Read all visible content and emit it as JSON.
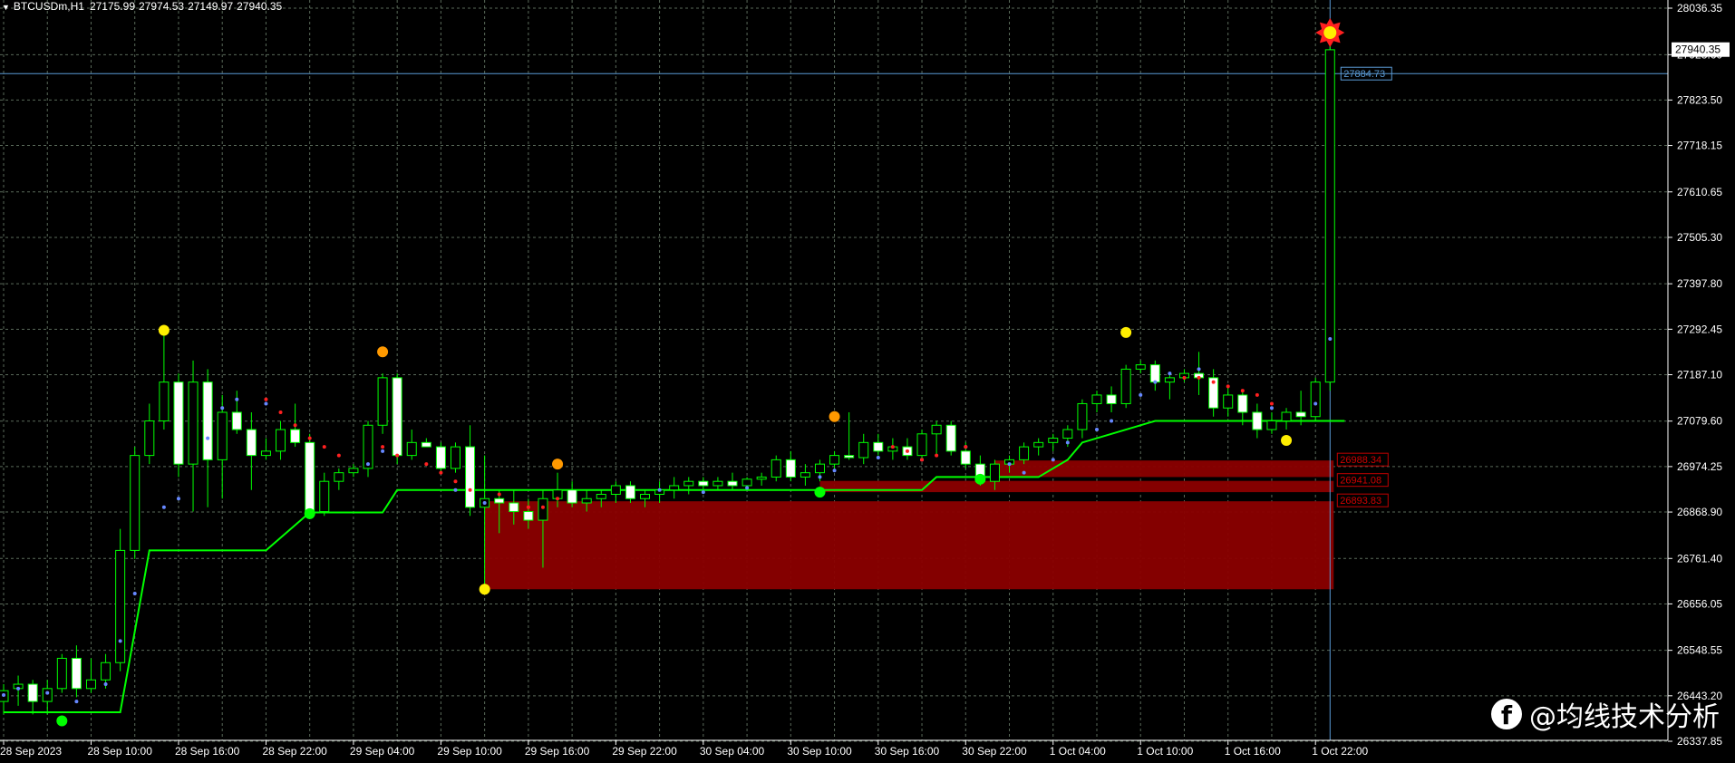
{
  "header": {
    "symbol": "BTCUSDm,H1",
    "open": "27175.99",
    "high": "27974.53",
    "low": "27149.97",
    "close": "27940.35"
  },
  "watermark": {
    "text": "@均线技术分析",
    "icon": "facebook-icon"
  },
  "colors": {
    "background": "#000000",
    "grid": "#5a6a5a",
    "axis": "#ffffff",
    "bull_wick": "#00ff00",
    "bear_body": "#ffffff",
    "trail_line": "#00ff00",
    "zone_fill": "#8b0000",
    "hline": "#5b9bd5",
    "swing_high": "#ffee00",
    "swing_mid": "#ff9900",
    "swing_low": "#00ff00",
    "dot_blue": "#6688ff",
    "dot_red": "#ff2020"
  },
  "chart_data": {
    "type": "candlestick",
    "symbol": "BTCUSDm",
    "timeframe": "H1",
    "ylim": [
      26337.85,
      28036.35
    ],
    "y_ticks": [
      "28036.35",
      "27928.60",
      "27823.50",
      "27718.15",
      "27610.65",
      "27505.30",
      "27397.80",
      "27292.45",
      "27187.10",
      "27079.60",
      "26974.25",
      "26868.90",
      "26761.40",
      "26656.05",
      "26548.55",
      "26443.20",
      "26337.85"
    ],
    "x_ticks": [
      "28 Sep 2023",
      "28 Sep 10:00",
      "28 Sep 16:00",
      "28 Sep 22:00",
      "29 Sep 04:00",
      "29 Sep 10:00",
      "29 Sep 16:00",
      "29 Sep 22:00",
      "30 Sep 04:00",
      "30 Sep 10:00",
      "30 Sep 16:00",
      "30 Sep 22:00",
      "1 Oct 04:00",
      "1 Oct 10:00",
      "1 Oct 16:00",
      "1 Oct 22:00"
    ],
    "x_tick_bars": [
      0,
      6,
      12,
      18,
      24,
      30,
      36,
      42,
      48,
      54,
      60,
      66,
      72,
      78,
      84,
      90
    ],
    "candles": [
      {
        "o": 26430,
        "h": 26470,
        "l": 26400,
        "c": 26455
      },
      {
        "o": 26460,
        "h": 26490,
        "l": 26420,
        "c": 26470
      },
      {
        "o": 26470,
        "h": 26480,
        "l": 26400,
        "c": 26430
      },
      {
        "o": 26430,
        "h": 26480,
        "l": 26400,
        "c": 26460
      },
      {
        "o": 26460,
        "h": 26540,
        "l": 26450,
        "c": 26530
      },
      {
        "o": 26530,
        "h": 26560,
        "l": 26440,
        "c": 26460
      },
      {
        "o": 26460,
        "h": 26530,
        "l": 26450,
        "c": 26480
      },
      {
        "o": 26480,
        "h": 26540,
        "l": 26460,
        "c": 26520
      },
      {
        "o": 26520,
        "h": 26830,
        "l": 26500,
        "c": 26780
      },
      {
        "o": 26780,
        "h": 27020,
        "l": 26760,
        "c": 27000
      },
      {
        "o": 27000,
        "h": 27120,
        "l": 26980,
        "c": 27080
      },
      {
        "o": 27080,
        "h": 27290,
        "l": 27060,
        "c": 27170
      },
      {
        "o": 27170,
        "h": 27190,
        "l": 26950,
        "c": 26980
      },
      {
        "o": 26980,
        "h": 27220,
        "l": 26870,
        "c": 27170
      },
      {
        "o": 27170,
        "h": 27200,
        "l": 26880,
        "c": 26990
      },
      {
        "o": 26990,
        "h": 27140,
        "l": 26900,
        "c": 27100
      },
      {
        "o": 27100,
        "h": 27150,
        "l": 27050,
        "c": 27060
      },
      {
        "o": 27060,
        "h": 27100,
        "l": 26920,
        "c": 27000
      },
      {
        "o": 27000,
        "h": 27040,
        "l": 26990,
        "c": 27010
      },
      {
        "o": 27010,
        "h": 27080,
        "l": 26990,
        "c": 27060
      },
      {
        "o": 27060,
        "h": 27120,
        "l": 27020,
        "c": 27030
      },
      {
        "o": 27030,
        "h": 27050,
        "l": 26860,
        "c": 26870
      },
      {
        "o": 26870,
        "h": 26960,
        "l": 26860,
        "c": 26940
      },
      {
        "o": 26940,
        "h": 26970,
        "l": 26920,
        "c": 26960
      },
      {
        "o": 26960,
        "h": 26980,
        "l": 26950,
        "c": 26970
      },
      {
        "o": 26970,
        "h": 27080,
        "l": 26950,
        "c": 27070
      },
      {
        "o": 27070,
        "h": 27190,
        "l": 27050,
        "c": 27180
      },
      {
        "o": 27180,
        "h": 27190,
        "l": 26980,
        "c": 27000
      },
      {
        "o": 27000,
        "h": 27060,
        "l": 26990,
        "c": 27030
      },
      {
        "o": 27030,
        "h": 27040,
        "l": 27020,
        "c": 27020
      },
      {
        "o": 27020,
        "h": 27030,
        "l": 26960,
        "c": 26970
      },
      {
        "o": 26970,
        "h": 27030,
        "l": 26960,
        "c": 27020
      },
      {
        "o": 27020,
        "h": 27070,
        "l": 26860,
        "c": 26880
      },
      {
        "o": 26880,
        "h": 27000,
        "l": 26700,
        "c": 26900
      },
      {
        "o": 26900,
        "h": 26920,
        "l": 26820,
        "c": 26890
      },
      {
        "o": 26890,
        "h": 26920,
        "l": 26840,
        "c": 26870
      },
      {
        "o": 26870,
        "h": 26900,
        "l": 26830,
        "c": 26850
      },
      {
        "o": 26850,
        "h": 26920,
        "l": 26740,
        "c": 26900
      },
      {
        "o": 26900,
        "h": 26960,
        "l": 26880,
        "c": 26920
      },
      {
        "o": 26920,
        "h": 26940,
        "l": 26880,
        "c": 26890
      },
      {
        "o": 26890,
        "h": 26920,
        "l": 26870,
        "c": 26900
      },
      {
        "o": 26900,
        "h": 26920,
        "l": 26880,
        "c": 26910
      },
      {
        "o": 26910,
        "h": 26940,
        "l": 26890,
        "c": 26930
      },
      {
        "o": 26930,
        "h": 26940,
        "l": 26890,
        "c": 26900
      },
      {
        "o": 26900,
        "h": 26920,
        "l": 26880,
        "c": 26910
      },
      {
        "o": 26910,
        "h": 26940,
        "l": 26890,
        "c": 26920
      },
      {
        "o": 26920,
        "h": 26950,
        "l": 26900,
        "c": 26930
      },
      {
        "o": 26930,
        "h": 26950,
        "l": 26910,
        "c": 26940
      },
      {
        "o": 26940,
        "h": 26950,
        "l": 26920,
        "c": 26930
      },
      {
        "o": 26930,
        "h": 26950,
        "l": 26920,
        "c": 26940
      },
      {
        "o": 26940,
        "h": 26960,
        "l": 26920,
        "c": 26930
      },
      {
        "o": 26930,
        "h": 26950,
        "l": 26920,
        "c": 26945
      },
      {
        "o": 26945,
        "h": 26960,
        "l": 26930,
        "c": 26950
      },
      {
        "o": 26950,
        "h": 27000,
        "l": 26940,
        "c": 26990
      },
      {
        "o": 26990,
        "h": 27010,
        "l": 26940,
        "c": 26950
      },
      {
        "o": 26950,
        "h": 26980,
        "l": 26930,
        "c": 26960
      },
      {
        "o": 26960,
        "h": 26990,
        "l": 26940,
        "c": 26980
      },
      {
        "o": 26980,
        "h": 27010,
        "l": 26970,
        "c": 27000
      },
      {
        "o": 27000,
        "h": 27100,
        "l": 26990,
        "c": 26995
      },
      {
        "o": 26995,
        "h": 27050,
        "l": 26980,
        "c": 27030
      },
      {
        "o": 27030,
        "h": 27050,
        "l": 27000,
        "c": 27010
      },
      {
        "o": 27010,
        "h": 27040,
        "l": 26990,
        "c": 27020
      },
      {
        "o": 27020,
        "h": 27040,
        "l": 26990,
        "c": 27000
      },
      {
        "o": 27000,
        "h": 27060,
        "l": 26990,
        "c": 27050
      },
      {
        "o": 27050,
        "h": 27080,
        "l": 27000,
        "c": 27070
      },
      {
        "o": 27070,
        "h": 27080,
        "l": 27000,
        "c": 27010
      },
      {
        "o": 27010,
        "h": 27030,
        "l": 26970,
        "c": 26980
      },
      {
        "o": 26980,
        "h": 27000,
        "l": 26930,
        "c": 26940
      },
      {
        "o": 26940,
        "h": 26990,
        "l": 26920,
        "c": 26980
      },
      {
        "o": 26980,
        "h": 27000,
        "l": 26960,
        "c": 26990
      },
      {
        "o": 26990,
        "h": 27030,
        "l": 26980,
        "c": 27020
      },
      {
        "o": 27020,
        "h": 27040,
        "l": 27000,
        "c": 27030
      },
      {
        "o": 27030,
        "h": 27050,
        "l": 27010,
        "c": 27040
      },
      {
        "o": 27040,
        "h": 27070,
        "l": 27020,
        "c": 27060
      },
      {
        "o": 27060,
        "h": 27130,
        "l": 27040,
        "c": 27120
      },
      {
        "o": 27120,
        "h": 27150,
        "l": 27100,
        "c": 27140
      },
      {
        "o": 27140,
        "h": 27160,
        "l": 27100,
        "c": 27120
      },
      {
        "o": 27120,
        "h": 27210,
        "l": 27110,
        "c": 27200
      },
      {
        "o": 27200,
        "h": 27220,
        "l": 27190,
        "c": 27210
      },
      {
        "o": 27210,
        "h": 27220,
        "l": 27150,
        "c": 27170
      },
      {
        "o": 27170,
        "h": 27190,
        "l": 27130,
        "c": 27180
      },
      {
        "o": 27180,
        "h": 27200,
        "l": 27170,
        "c": 27190
      },
      {
        "o": 27190,
        "h": 27240,
        "l": 27140,
        "c": 27180
      },
      {
        "o": 27180,
        "h": 27200,
        "l": 27090,
        "c": 27110
      },
      {
        "o": 27110,
        "h": 27160,
        "l": 27090,
        "c": 27140
      },
      {
        "o": 27140,
        "h": 27150,
        "l": 27070,
        "c": 27100
      },
      {
        "o": 27100,
        "h": 27120,
        "l": 27040,
        "c": 27060
      },
      {
        "o": 27060,
        "h": 27100,
        "l": 27050,
        "c": 27080
      },
      {
        "o": 27080,
        "h": 27110,
        "l": 27060,
        "c": 27100
      },
      {
        "o": 27100,
        "h": 27150,
        "l": 27070,
        "c": 27090
      },
      {
        "o": 27090,
        "h": 27180,
        "l": 27080,
        "c": 27170
      },
      {
        "o": 27170,
        "h": 27975,
        "l": 27150,
        "c": 27940
      }
    ],
    "trail_line": [
      [
        0,
        26405
      ],
      [
        8,
        26405
      ],
      [
        10,
        26780
      ],
      [
        18,
        26780
      ],
      [
        21,
        26868
      ],
      [
        26,
        26868
      ],
      [
        27,
        26920
      ],
      [
        56,
        26920
      ],
      [
        63,
        26920
      ],
      [
        64,
        26950
      ],
      [
        71,
        26950
      ],
      [
        73,
        26990
      ],
      [
        74,
        27030
      ],
      [
        77,
        27060
      ],
      [
        79,
        27080
      ],
      [
        92,
        27080
      ]
    ],
    "dots_blue": [
      [
        0,
        26445
      ],
      [
        1,
        26460
      ],
      [
        3,
        26450
      ],
      [
        5,
        26430
      ],
      [
        7,
        26470
      ],
      [
        8,
        26570
      ],
      [
        9,
        26680
      ],
      [
        11,
        26880
      ],
      [
        12,
        26900
      ],
      [
        14,
        27040
      ],
      [
        15,
        27110
      ],
      [
        16,
        27130
      ],
      [
        18,
        27120
      ],
      [
        25,
        26980
      ],
      [
        26,
        27010
      ],
      [
        31,
        26920
      ],
      [
        33,
        26890
      ],
      [
        45,
        26920
      ],
      [
        48,
        26915
      ],
      [
        51,
        26925
      ],
      [
        56,
        26950
      ],
      [
        57,
        26965
      ],
      [
        60,
        26995
      ],
      [
        63,
        26990
      ],
      [
        66,
        27020
      ],
      [
        69,
        26980
      ],
      [
        70,
        26960
      ],
      [
        72,
        26990
      ],
      [
        73,
        27030
      ],
      [
        75,
        27060
      ],
      [
        76,
        27080
      ],
      [
        78,
        27140
      ],
      [
        79,
        27170
      ],
      [
        80,
        27190
      ],
      [
        82,
        27200
      ],
      [
        87,
        27110
      ],
      [
        90,
        27120
      ],
      [
        91,
        27270
      ]
    ],
    "dots_red": [
      [
        18,
        27130
      ],
      [
        19,
        27100
      ],
      [
        20,
        27070
      ],
      [
        21,
        27040
      ],
      [
        22,
        27020
      ],
      [
        23,
        27000
      ],
      [
        26,
        27020
      ],
      [
        27,
        27000
      ],
      [
        29,
        26980
      ],
      [
        30,
        26960
      ],
      [
        31,
        26940
      ],
      [
        32,
        26920
      ],
      [
        34,
        26910
      ],
      [
        36,
        26880
      ],
      [
        37,
        26880
      ],
      [
        38,
        26900
      ],
      [
        61,
        27020
      ],
      [
        62,
        27010
      ],
      [
        63,
        26990
      ],
      [
        64,
        27000
      ],
      [
        66,
        27020
      ],
      [
        81,
        27180
      ],
      [
        82,
        27180
      ],
      [
        83,
        27170
      ],
      [
        84,
        27160
      ],
      [
        85,
        27150
      ],
      [
        86,
        27140
      ],
      [
        87,
        27120
      ]
    ],
    "swing_points": [
      {
        "bar": 11,
        "price": 27290,
        "color": "#ffee00"
      },
      {
        "bar": 26,
        "price": 27240,
        "color": "#ff9900"
      },
      {
        "bar": 33,
        "price": 26690,
        "color": "#ffee00"
      },
      {
        "bar": 38,
        "price": 26980,
        "color": "#ff9900"
      },
      {
        "bar": 57,
        "price": 27090,
        "color": "#ff9900"
      },
      {
        "bar": 77,
        "price": 27285,
        "color": "#ffee00"
      },
      {
        "bar": 88,
        "price": 27035,
        "color": "#ffee00"
      },
      {
        "bar": 4,
        "price": 26385,
        "color": "#00ff00"
      },
      {
        "bar": 21,
        "price": 26865,
        "color": "#00ff00"
      },
      {
        "bar": 56,
        "price": 26915,
        "color": "#00ff00"
      },
      {
        "bar": 67,
        "price": 26945,
        "color": "#00ff00"
      }
    ],
    "zones": [
      {
        "from_bar": 33,
        "to_bar": 91,
        "top": 26893.83,
        "bottom": 26690,
        "label": "26893.83"
      },
      {
        "from_bar": 56,
        "to_bar": 91,
        "top": 26941.08,
        "bottom": 26915,
        "label": "26941.08"
      },
      {
        "from_bar": 68,
        "to_bar": 91,
        "top": 26988.34,
        "bottom": 26950,
        "label": "26988.34"
      }
    ],
    "hlines": [
      {
        "price": 27884.73,
        "label": "27884.73"
      }
    ],
    "current_price": {
      "price": 27940.35,
      "label": "27940.35"
    },
    "arrow_bar": 91
  }
}
